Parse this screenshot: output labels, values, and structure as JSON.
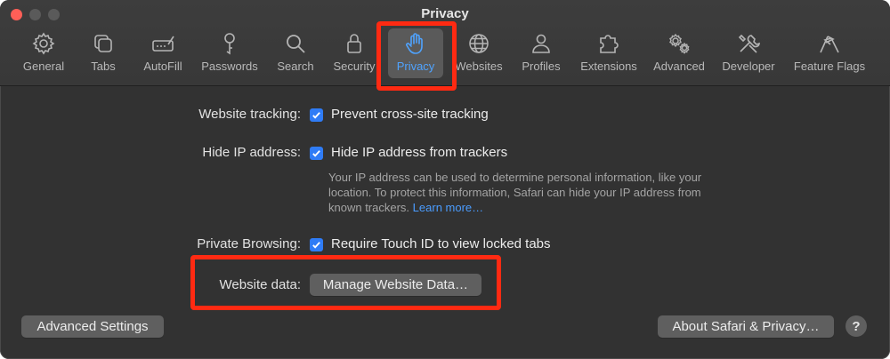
{
  "window": {
    "title": "Privacy"
  },
  "toolbar": {
    "items": [
      {
        "label": "General",
        "icon": "gear-icon"
      },
      {
        "label": "Tabs",
        "icon": "tabs-icon"
      },
      {
        "label": "AutoFill",
        "icon": "autofill-icon"
      },
      {
        "label": "Passwords",
        "icon": "key-icon"
      },
      {
        "label": "Search",
        "icon": "search-icon"
      },
      {
        "label": "Security",
        "icon": "lock-icon"
      },
      {
        "label": "Privacy",
        "icon": "hand-icon",
        "selected": true
      },
      {
        "label": "Websites",
        "icon": "globe-icon"
      },
      {
        "label": "Profiles",
        "icon": "person-icon"
      },
      {
        "label": "Extensions",
        "icon": "puzzle-icon"
      },
      {
        "label": "Advanced",
        "icon": "gears-icon"
      },
      {
        "label": "Developer",
        "icon": "tools-icon"
      },
      {
        "label": "Feature Flags",
        "icon": "flags-icon"
      }
    ]
  },
  "settings": {
    "tracking_label": "Website tracking:",
    "tracking_option": "Prevent cross-site tracking",
    "hide_ip_label": "Hide IP address:",
    "hide_ip_option": "Hide IP address from trackers",
    "hide_ip_note": "Your IP address can be used to determine personal information, like your location. To protect this information, Safari can hide your IP address from known trackers.",
    "learn_more": "Learn more…",
    "private_label": "Private Browsing:",
    "private_option": "Require Touch ID to view locked tabs",
    "website_data_label": "Website data:",
    "manage_button": "Manage Website Data…"
  },
  "footer": {
    "advanced_button": "Advanced Settings",
    "about_button": "About Safari & Privacy…",
    "help_button": "?"
  },
  "colors": {
    "accent": "#2f7cf6",
    "annotation": "#ff2a12",
    "selected_label": "#4fa3ff"
  }
}
